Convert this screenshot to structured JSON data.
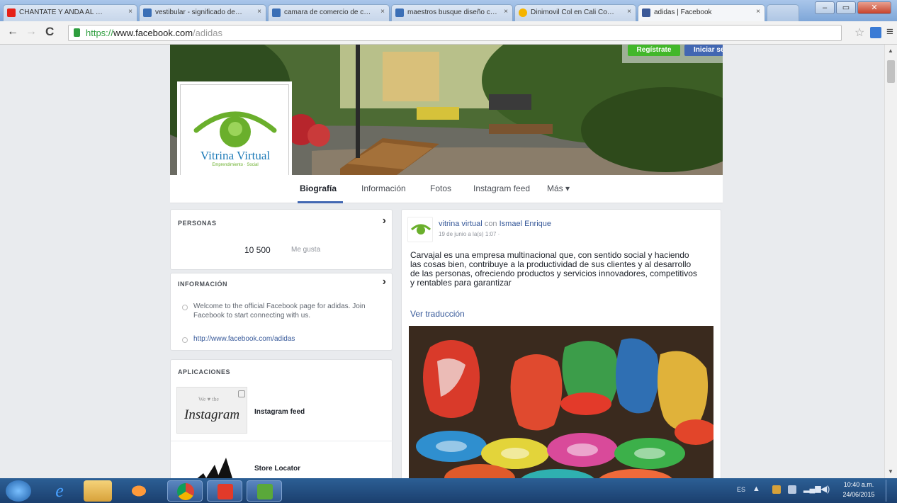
{
  "browser": {
    "tabs": [
      {
        "label": "CHANTATE Y ANDA AL …",
        "color": "#e62117"
      },
      {
        "label": "vestibular - significado de…",
        "color": "#3b6fb6"
      },
      {
        "label": "camara de comercio de c…",
        "color": "#3b6fb6"
      },
      {
        "label": "maestros busque diseño c…",
        "color": "#3b6fb6"
      },
      {
        "label": "Dinimovil Col en Cali Co…",
        "color": "#f5b400"
      },
      {
        "label": "adidas | Facebook",
        "color": "#3b5998"
      }
    ],
    "url_scheme": "https://",
    "url_domain": "www.facebook.com",
    "url_path": "/adidas"
  },
  "header": {
    "register_label": "Regístrate",
    "login_label": "Iniciar sesión"
  },
  "profile": {
    "logo_text": "Vitrina Virtual",
    "logo_subtext": "Emprendimiento · Social"
  },
  "nav": {
    "tabs": [
      "Biografía",
      "Información",
      "Fotos",
      "Instagram feed",
      "Más ▾"
    ]
  },
  "people": {
    "heading": "PERSONAS",
    "likes_count": "10 500",
    "likes_label": "Me gusta"
  },
  "info": {
    "heading": "INFORMACIÓN",
    "description": "Welcome to the official Facebook page for adidas. Join Facebook to start connecting with us.",
    "website": "http://www.facebook.com/adidas"
  },
  "apps": {
    "heading": "APLICACIONES",
    "items": [
      {
        "name": "Instagram feed",
        "thumb_top": "We ♥ the",
        "thumb_main": "Instagram"
      },
      {
        "name": "Store Locator",
        "thumb_main": "adidas"
      }
    ]
  },
  "post": {
    "author": "vitrina virtual",
    "with_word": "con",
    "tagged": "Ismael Enrique",
    "timestamp": "19 de junio a la(s) 1:07 ·",
    "text": "Carvajal es una empresa multinacional que, con sentido social y haciendo las cosas bien, contribuye a la productividad de sus clientes y al desarrollo de las personas, ofreciendo productos y servicios innovadores, competitivos y rentables para garantizar",
    "translate_label": "Ver traducción"
  },
  "taskbar": {
    "time": "10:40 a.m.",
    "date": "24/06/2015",
    "lang": "ES"
  },
  "colors": {
    "facebook_blue": "#4267b2",
    "register_green": "#42b72a",
    "logo_green": "#6aaf2c"
  }
}
